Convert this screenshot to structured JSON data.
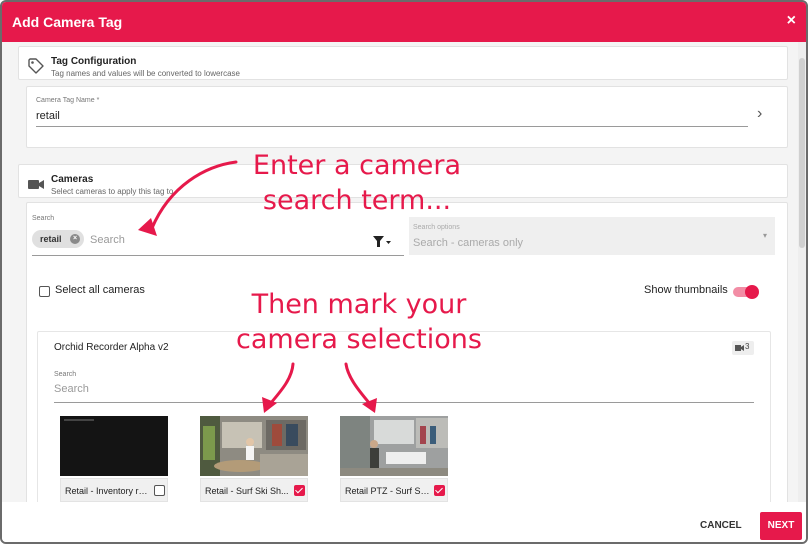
{
  "dialog": {
    "title": "Add Camera Tag",
    "close_glyph": "×",
    "accent_color": "#e6194b"
  },
  "tag_config": {
    "icon": "tag-icon",
    "title": "Tag Configuration",
    "subtitle": "Tag names and values will be converted to lowercase",
    "name_label": "Camera Tag Name *",
    "name_value": "retail",
    "chevron_glyph": "›"
  },
  "cameras": {
    "icon": "video-camera-icon",
    "title": "Cameras",
    "subtitle": "Select cameras to apply this tag to",
    "search_label": "Search",
    "search_chip": "retail",
    "search_placeholder": "Search",
    "search_options_label": "Search options",
    "search_options_value": "Search - cameras only",
    "select_all_label": "Select all cameras",
    "select_all_checked": false,
    "show_thumbnails_label": "Show thumbnails",
    "show_thumbnails_on": true
  },
  "recorder": {
    "name": "Orchid Recorder Alpha v2",
    "camera_count": "3",
    "search_label": "Search",
    "search_placeholder": "Search",
    "cameras": [
      {
        "label": "Retail - Inventory ro...",
        "checked": false
      },
      {
        "label": "Retail - Surf Ski Sh...",
        "checked": true
      },
      {
        "label": "Retail PTZ - Surf Sk...",
        "checked": true
      }
    ]
  },
  "annotations": {
    "search_hint": [
      "Enter a camera",
      "search term..."
    ],
    "select_hint": [
      "Then mark your",
      "camera selections"
    ]
  },
  "footer": {
    "cancel_label": "CANCEL",
    "next_label": "NEXT"
  }
}
